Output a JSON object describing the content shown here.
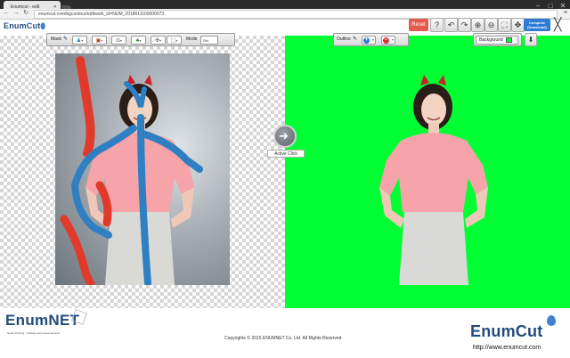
{
  "browser": {
    "tab_title": "Enumcut - edit",
    "url": "enumcut.com/bgcontour/editwork_id=NUM_2018011100000073"
  },
  "app": {
    "logo": "EnumCut",
    "reset_label": "Reset",
    "complete_label": "Complete",
    "complete_sub": "(Download)"
  },
  "mask_toolbar": {
    "label": "Mask",
    "mode_label": "Mode",
    "mode_value": "Sel"
  },
  "outline_toolbar": {
    "label": "Outline",
    "background_label": "Background",
    "background_color": "#00ff33"
  },
  "center": {
    "active_click_label": "Active Click"
  },
  "footer": {
    "company_logo": "EnumNET",
    "company_tagline": "Smart thinking : software and visual services",
    "copyright": "Copyrights © 2015 ENUMNET Co. Ltd. All Rights Reserved",
    "product_logo": "EnumCut",
    "website": "http://www.enumcut.com"
  },
  "colors": {
    "foreground_stroke": "#2f7fc3",
    "background_stroke": "#e23a2a",
    "output_background": "#00ff33",
    "reset": "#e25b4f",
    "complete": "#2e7bd6"
  }
}
